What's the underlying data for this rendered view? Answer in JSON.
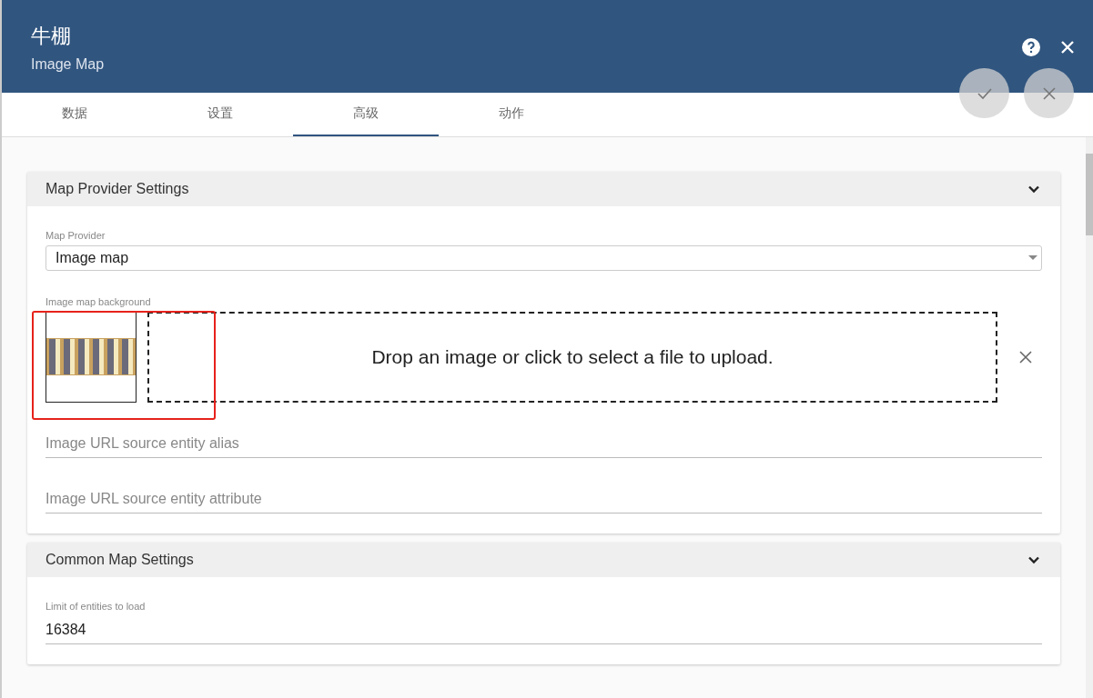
{
  "dialog": {
    "title": "牛棚",
    "subtitle": "Image Map"
  },
  "tabs": [
    {
      "label": "数据",
      "selected": false
    },
    {
      "label": "设置",
      "selected": false
    },
    {
      "label": "高级",
      "selected": true
    },
    {
      "label": "动作",
      "selected": false
    }
  ],
  "sections": [
    {
      "title": "Map Provider Settings",
      "expanded": true,
      "fields": [
        {
          "kind": "select",
          "label": "Map Provider",
          "value": "Image map"
        },
        {
          "kind": "image",
          "label": "Image map background",
          "drop_text": "Drop an image or click to select a file to upload.",
          "highlighted": true
        },
        {
          "kind": "input",
          "placeholder": "Image URL source entity alias"
        },
        {
          "kind": "input",
          "placeholder": "Image URL source entity attribute"
        }
      ]
    },
    {
      "title": "Common Map Settings",
      "expanded": true,
      "fields": [
        {
          "kind": "input",
          "label": "Limit of entities to load",
          "value": "16384"
        }
      ]
    }
  ]
}
